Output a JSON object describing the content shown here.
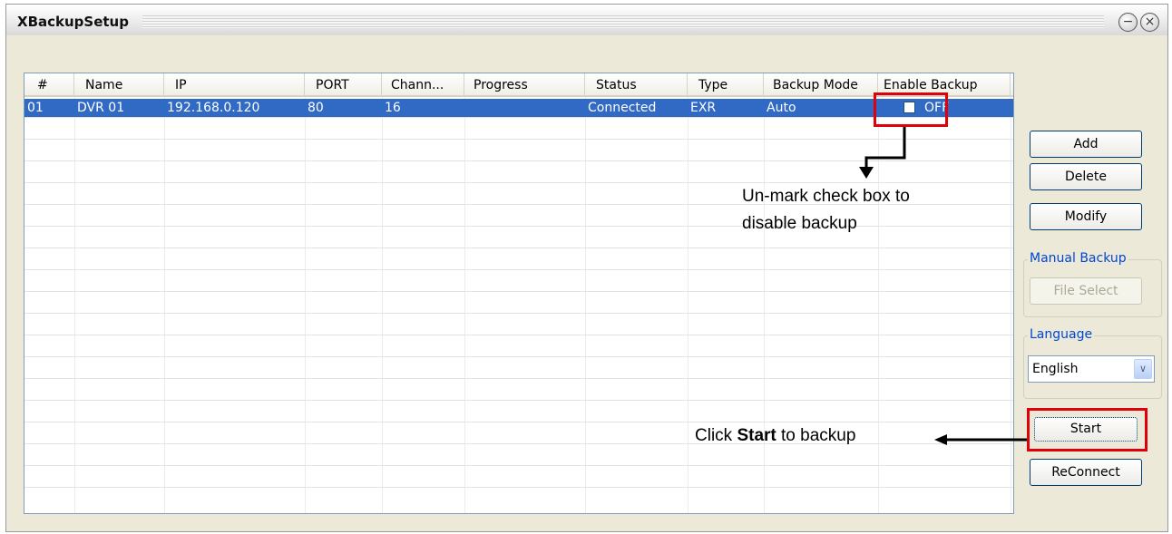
{
  "window": {
    "title": "XBackupSetup",
    "minimize_glyph": "−",
    "close_glyph": "×"
  },
  "table": {
    "columns": [
      "#",
      "Name",
      "IP",
      "PORT",
      "Chann...",
      "Progress",
      "Status",
      "Type",
      "Backup Mode",
      "Enable Backup"
    ],
    "rows": [
      {
        "num": "01",
        "name": "DVR 01",
        "ip": "192.168.0.120",
        "port": "80",
        "channels": "16",
        "progress": "",
        "status": "Connected",
        "type": "EXR",
        "backup_mode": "Auto",
        "enable_backup": "OFF",
        "enable_checked": false
      }
    ]
  },
  "buttons": {
    "add": "Add",
    "delete": "Delete",
    "modify": "Modify",
    "file_select": "File Select",
    "start": "Start",
    "reconnect": "ReConnect"
  },
  "manual_backup": {
    "label": "Manual Backup"
  },
  "language": {
    "label": "Language",
    "value": "English",
    "arrow": "∨"
  },
  "annotations": {
    "uncheck_line1": "Un-mark check box to",
    "uncheck_line2": "disable backup",
    "click_pre": "Click ",
    "click_bold": "Start",
    "click_post": " to backup"
  },
  "colors": {
    "selection": "#316ac5",
    "highlight": "#e0000a",
    "group_label": "#0046d5"
  }
}
